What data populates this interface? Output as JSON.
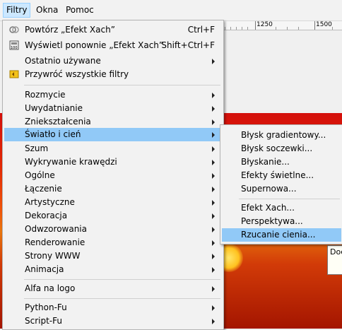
{
  "menubar": {
    "filtry": "Filtry",
    "okna": "Okna",
    "pomoc": "Pomoc"
  },
  "ruler": {
    "mark1": "1250",
    "mark2": "1500"
  },
  "tooltip": "Doc",
  "main_menu": {
    "repeat": {
      "label": "Powtórz „Efekt Xach”",
      "shortcut": "Ctrl+F"
    },
    "reshow": {
      "label": "Wyświetl ponownie „Efekt Xach”",
      "shortcut": "Shift+Ctrl+F"
    },
    "recent": "Ostatnio używane",
    "reset_all": "Przywróć wszystkie filtry",
    "blur": "Rozmycie",
    "enhance": "Uwydatnianie",
    "distorts": "Zniekształcenia",
    "light_shadow": "Światło i cień",
    "noise": "Szum",
    "edge_detect": "Wykrywanie krawędzi",
    "generic": "Ogólne",
    "combine": "Łączenie",
    "artistic": "Artystyczne",
    "decor": "Dekoracja",
    "map": "Odwzorowania",
    "render": "Renderowanie",
    "web": "Strony WWW",
    "animation": "Animacja",
    "alpha_logo": "Alfa na logo",
    "python_fu": "Python-Fu",
    "script_fu": "Script-Fu"
  },
  "sub_menu": {
    "gradient_flare": "Błysk gradientowy...",
    "lens_flare": "Błysk soczewki...",
    "sparkle": "Błyskanie...",
    "lighting": "Efekty świetlne...",
    "supernova": "Supernowa...",
    "xach": "Efekt Xach...",
    "perspective": "Perspektywa...",
    "drop_shadow": "Rzucanie cienia..."
  }
}
